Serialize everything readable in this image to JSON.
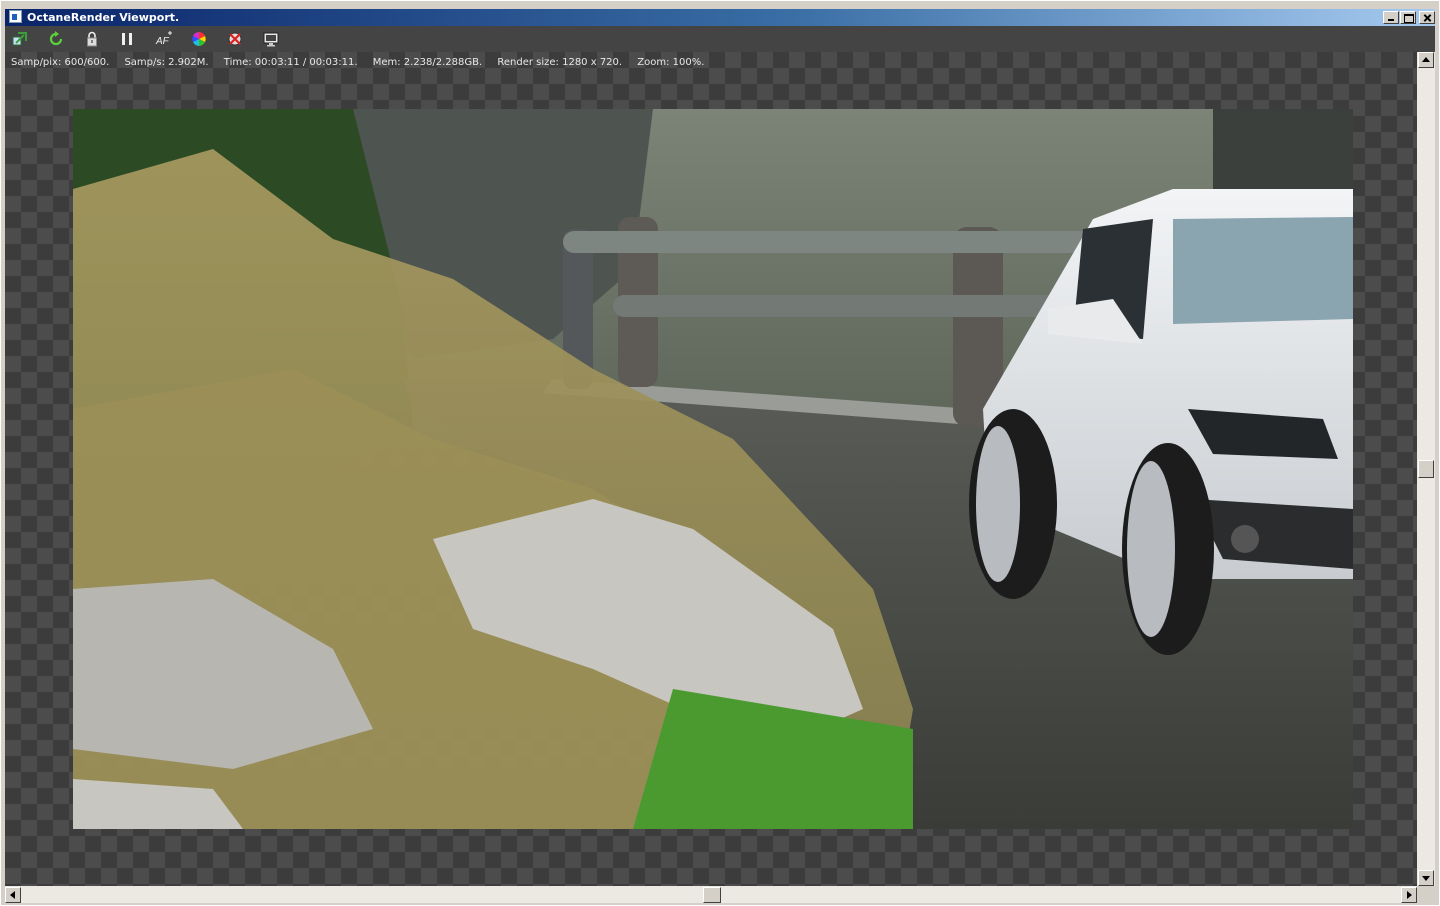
{
  "window": {
    "title": "OctaneRender Viewport."
  },
  "toolbar": {
    "buttons": [
      {
        "name": "recenter-view",
        "icon": "recenter-icon"
      },
      {
        "name": "restart-render",
        "icon": "refresh-icon"
      },
      {
        "name": "lock-resolution",
        "icon": "lock-icon"
      },
      {
        "name": "pause-render",
        "icon": "pause-icon"
      },
      {
        "name": "autofocus-picking",
        "icon": "af-icon",
        "label": "AF"
      },
      {
        "name": "white-balance-picking",
        "icon": "color-wheel-icon"
      },
      {
        "name": "material-picking",
        "icon": "picker-icon"
      },
      {
        "name": "region-render",
        "icon": "monitor-icon"
      }
    ]
  },
  "status": {
    "samples_per_pixel": "Samp/pix: 600/600.",
    "samples_per_second": "Samp/s: 2.902M.",
    "time": "Time: 00:03:11 / 00:03:11.",
    "memory": "Mem: 2.238/2.288GB.",
    "render_size": "Render size: 1280 x 720.",
    "zoom": "Zoom: 100%."
  },
  "render": {
    "description_colors": {
      "road": "#4a4a46",
      "grass": "#b8a468",
      "rock": "#8c9088",
      "car": "#e4e8ec",
      "rail": "#707874"
    }
  },
  "colors": {
    "title_start": "#0a246a",
    "title_end": "#a6caf0",
    "toolbar": "#444444",
    "checker_dark": "#3c3c3c",
    "checker_light": "#4c4c4c"
  }
}
